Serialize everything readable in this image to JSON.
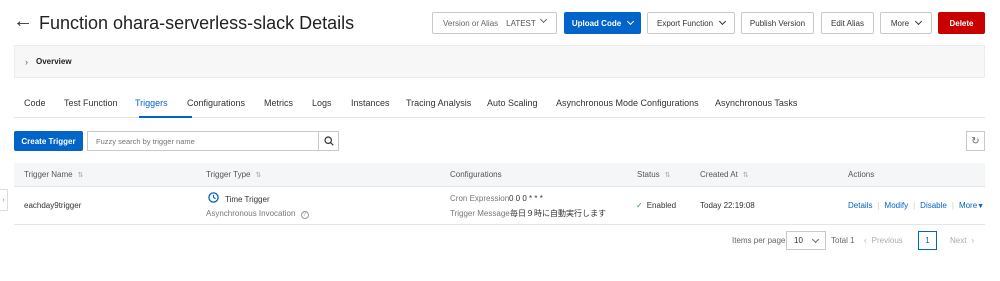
{
  "header": {
    "back_glyph": "←",
    "title": "Function ohara-serverless-slack Details",
    "version_alias_label": "Version or Alias",
    "version_alias_value": "LATEST",
    "upload_code": "Upload Code",
    "export_function": "Export Function",
    "publish_version": "Publish Version",
    "edit_alias": "Edit Alias",
    "more": "More",
    "delete": "Delete"
  },
  "overview": {
    "label": "Overview"
  },
  "tabs": [
    "Code",
    "Test Function",
    "Triggers",
    "Configurations",
    "Metrics",
    "Logs",
    "Instances",
    "Tracing Analysis",
    "Auto Scaling",
    "Asynchronous Mode Configurations",
    "Asynchronous Tasks"
  ],
  "active_tab": "Triggers",
  "toolbar": {
    "create_trigger": "Create Trigger",
    "search_placeholder": "Fuzzy search by trigger name"
  },
  "table": {
    "columns": [
      "Trigger Name",
      "Trigger Type",
      "Configurations",
      "Status",
      "Created At",
      "Actions"
    ],
    "rows": [
      {
        "name": "eachday9trigger",
        "type": "Time Trigger",
        "invocation": "Asynchronous Invocation",
        "cron_label": "Cron Expression",
        "cron_value": "0 0 0 * * *",
        "message_label": "Trigger Message",
        "message_value": "毎日９時に自動実行します",
        "status": "Enabled",
        "created_at": "Today 22:19:08",
        "actions": [
          "Details",
          "Modify",
          "Disable",
          "More"
        ]
      }
    ]
  },
  "pagination": {
    "items_per_page_label": "Items per page:",
    "items_per_page": "10",
    "total": "Total 1",
    "previous": "Previous",
    "current_page": "1",
    "next": "Next"
  },
  "colors": {
    "primary": "#0064c8",
    "danger": "#c80000",
    "success": "#2a9d3c"
  }
}
